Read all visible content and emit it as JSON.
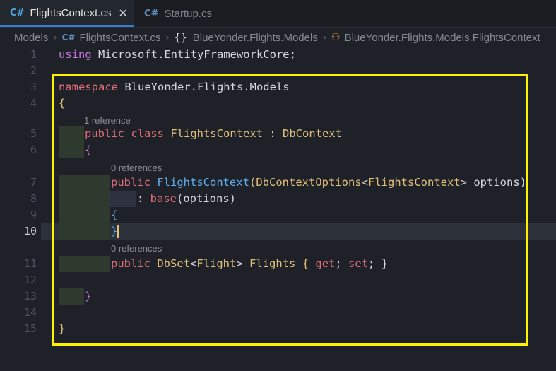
{
  "tabs": [
    {
      "label": "FlightsContext.cs",
      "active": true,
      "icon": "csharp-icon"
    },
    {
      "label": "Startup.cs",
      "active": false,
      "icon": "csharp-icon"
    }
  ],
  "breadcrumb": {
    "folder": "Models",
    "file": "FlightsContext.cs",
    "namespace": "BlueYonder.Flights.Models",
    "class": "BlueYonder.Flights.Models.FlightsContext"
  },
  "line_numbers": [
    "1",
    "2",
    "3",
    "4",
    "5",
    "6",
    "7",
    "8",
    "9",
    "10",
    "11",
    "12",
    "13",
    "14",
    "15"
  ],
  "current_line": "10",
  "code": {
    "l1_kw": "using",
    "l1_rest": " Microsoft.EntityFrameworkCore;",
    "l3_kw": "namespace",
    "l3_rest": " BlueYonder.Flights.Models",
    "l4": "{",
    "l5_pub": "public",
    "l5_class": "class",
    "l5_name": "FlightsContext",
    "l5_colon": " : ",
    "l5_base": "DbContext",
    "l6": "{",
    "l7_pub": "public",
    "l7_name": "FlightsContext",
    "l7_paren": "(",
    "l7_type": "DbContextOptions",
    "l7_lt": "<",
    "l7_gen": "FlightsContext",
    "l7_gt": ">",
    "l7_param": " options)",
    "l8_colon": ": ",
    "l8_base": "base",
    "l8_rest": "(options)",
    "l9": "{",
    "l10": "}",
    "l11_pub": "public",
    "l11_type": "DbSet",
    "l11_lt": "<",
    "l11_gen": "Flight",
    "l11_gt": ">",
    "l11_name": " Flights { ",
    "l11_get": "get",
    "l11_semi1": "; ",
    "l11_set": "set",
    "l11_end": "; }",
    "l13": "}",
    "l15": "}"
  },
  "codelens": {
    "class_refs": "1 reference",
    "ctor_refs": "0 references",
    "prop_refs": "0 references"
  },
  "colors": {
    "highlight_box": "#fff200",
    "keyword": "#c678dd",
    "type": "#e5c07b",
    "function": "#61afef"
  }
}
